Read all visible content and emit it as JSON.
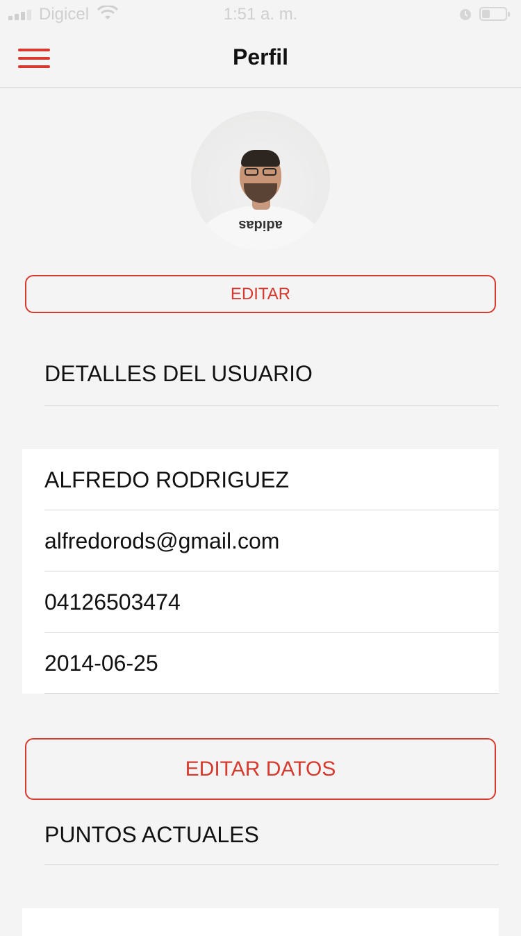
{
  "status_bar": {
    "carrier": "Digicel",
    "time": "1:51 a. m.",
    "battery_level": 0.35
  },
  "header": {
    "title": "Perfil"
  },
  "avatar": {
    "shirt_text": "adidas"
  },
  "buttons": {
    "edit_label": "EDITAR",
    "edit_data_label": "EDITAR DATOS"
  },
  "sections": {
    "user_details_title": "DETALLES DEL USUARIO",
    "current_points_title": "PUNTOS ACTUALES"
  },
  "user": {
    "name": "ALFREDO RODRIGUEZ",
    "email": "alfredorods@gmail.com",
    "phone": "04126503474",
    "date": "2014-06-25"
  },
  "icons": {
    "menu": "hamburger-menu-icon",
    "wifi": "wifi-icon",
    "alarm": "alarm-icon",
    "battery": "battery-icon",
    "signal": "signal-icon"
  },
  "colors": {
    "accent": "#d63a2e",
    "background": "#f4f4f4",
    "card": "#ffffff"
  }
}
